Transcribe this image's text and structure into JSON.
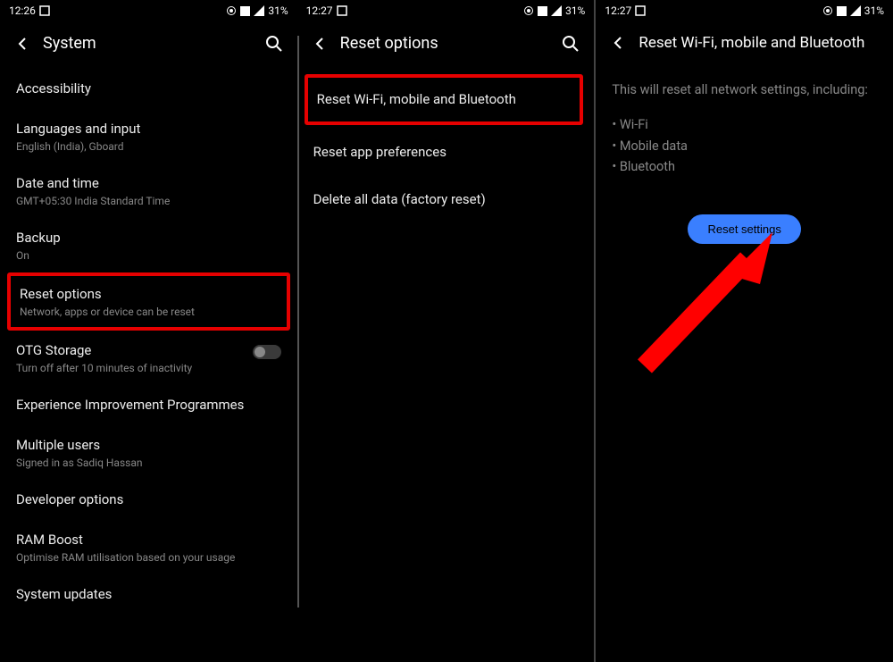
{
  "status": {
    "time_1": "12:26",
    "time_2": "12:27",
    "time_3": "12:27",
    "battery": "31%"
  },
  "panel1": {
    "title": "System",
    "items": [
      {
        "title": "Accessibility",
        "sub": ""
      },
      {
        "title": "Languages and input",
        "sub": "English (India), Gboard"
      },
      {
        "title": "Date and time",
        "sub": "GMT+05:30 India Standard Time"
      },
      {
        "title": "Backup",
        "sub": "On"
      },
      {
        "title": "Reset options",
        "sub": "Network, apps or device can be reset"
      },
      {
        "title": "OTG Storage",
        "sub": "Turn off after 10 minutes of inactivity"
      },
      {
        "title": "Experience Improvement Programmes",
        "sub": ""
      },
      {
        "title": "Multiple users",
        "sub": "Signed in as Sadiq Hassan"
      },
      {
        "title": "Developer options",
        "sub": ""
      },
      {
        "title": "RAM Boost",
        "sub": "Optimise RAM utilisation based on your usage"
      },
      {
        "title": "System updates",
        "sub": ""
      }
    ]
  },
  "panel2": {
    "title": "Reset options",
    "items": [
      {
        "title": "Reset Wi-Fi, mobile and Bluetooth"
      },
      {
        "title": "Reset app preferences"
      },
      {
        "title": "Delete all data (factory reset)"
      }
    ]
  },
  "panel3": {
    "title": "Reset Wi-Fi, mobile and Bluetooth",
    "desc": "This will reset all network settings, including:",
    "bullets": [
      "Wi-Fi",
      "Mobile data",
      "Bluetooth"
    ],
    "button": "Reset settings"
  }
}
